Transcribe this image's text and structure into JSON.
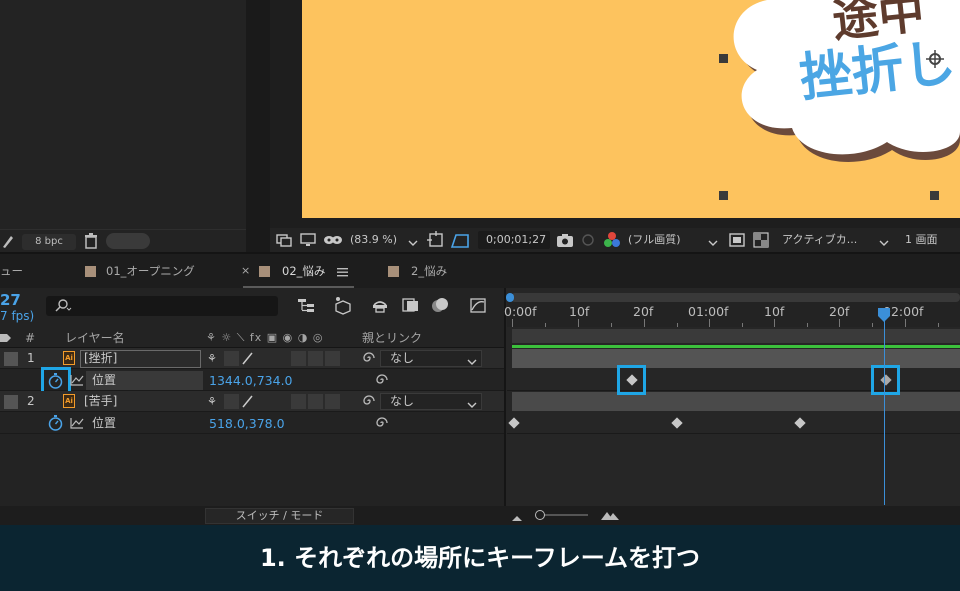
{
  "project": {
    "bpc_label": "8 bpc"
  },
  "viewer": {
    "comp_text_line1": "途中",
    "comp_text_line2": "挫折し",
    "zoom": "(83.9 %)",
    "timecode": "0;00;01;27",
    "resolution": "(フル画質)",
    "camera": "アクティブカ...",
    "views": "1 画面"
  },
  "tabs": [
    {
      "label": "ュー"
    },
    {
      "label": "01_オープニング"
    },
    {
      "label": "02_悩み",
      "active": true
    },
    {
      "label": "2_悩み"
    }
  ],
  "timeline": {
    "time_display": "27",
    "fps_display": "7 fps)",
    "columns": {
      "number": "#",
      "layer_name": "レイヤー名",
      "parent_link": "親とリンク"
    },
    "layers": [
      {
        "number": "1",
        "name": "[挫折]",
        "parent": "なし",
        "property": {
          "name": "位置",
          "value": "1344.0,734.0"
        }
      },
      {
        "number": "2",
        "name": "[苦手]",
        "parent": "なし",
        "property": {
          "name": "位置",
          "value": "518.0,378.0"
        }
      }
    ],
    "ruler_labels": [
      "0:00f",
      "10f",
      "20f",
      "01:00f",
      "10f",
      "20f",
      "02:00f"
    ],
    "switch_mode_label": "スイッチ / モード"
  },
  "caption": {
    "text": "1. それぞれの場所にキーフレームを打つ"
  },
  "colors": {
    "accent_blue": "#1fa6e6",
    "canvas_yellow": "#fdc35e",
    "value_blue": "#4aa3e8",
    "caption_bg": "#0b2531"
  }
}
